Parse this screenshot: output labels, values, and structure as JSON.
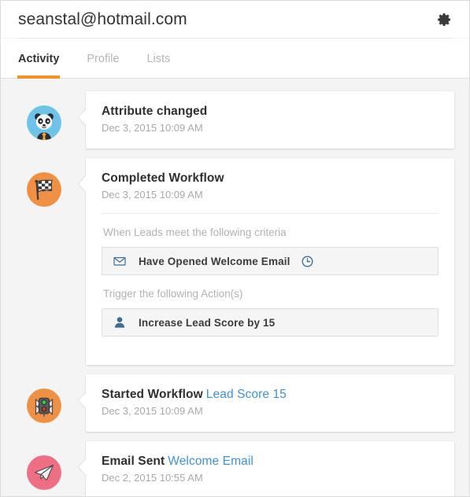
{
  "header": {
    "title": "seanstal@hotmail.com",
    "settings_icon": "gear-icon"
  },
  "tabs": [
    {
      "label": "Activity",
      "active": true
    },
    {
      "label": "Profile",
      "active": false
    },
    {
      "label": "Lists",
      "active": false
    }
  ],
  "colors": {
    "accent": "#f29324",
    "link": "#3e92d4",
    "page_bg": "#f4f4f4",
    "card_bg": "#ffffff",
    "rule_box_bg": "#f5f5f5",
    "avatar_blue": "#6ec3e8",
    "avatar_orange": "#ef9045",
    "avatar_pink": "#ee6f83",
    "icon_blue": "#3c6f96"
  },
  "activities": [
    {
      "avatar": "panda-avatar",
      "title": "Attribute changed",
      "link": "",
      "date": "Dec 3, 2015 10:09 AM"
    },
    {
      "avatar": "checkered-flag-avatar",
      "title": "Completed Workflow",
      "link": "",
      "date": "Dec 3, 2015 10:09 AM",
      "criteria_label": "When Leads meet the following criteria",
      "criteria": [
        {
          "icon": "envelope-icon",
          "text": "Have Opened Welcome Email",
          "trailing_icon": "clock-icon"
        }
      ],
      "actions_label": "Trigger the following Action(s)",
      "actions": [
        {
          "icon": "user-icon",
          "text": "Increase Lead Score by 15"
        }
      ]
    },
    {
      "avatar": "traffic-light-avatar",
      "title": "Started Workflow",
      "link": "Lead Score 15",
      "date": "Dec 3, 2015 10:09 AM"
    },
    {
      "avatar": "paper-plane-avatar",
      "title": "Email Sent",
      "link": "Welcome Email",
      "date": "Dec 2, 2015 10:55 AM"
    }
  ]
}
